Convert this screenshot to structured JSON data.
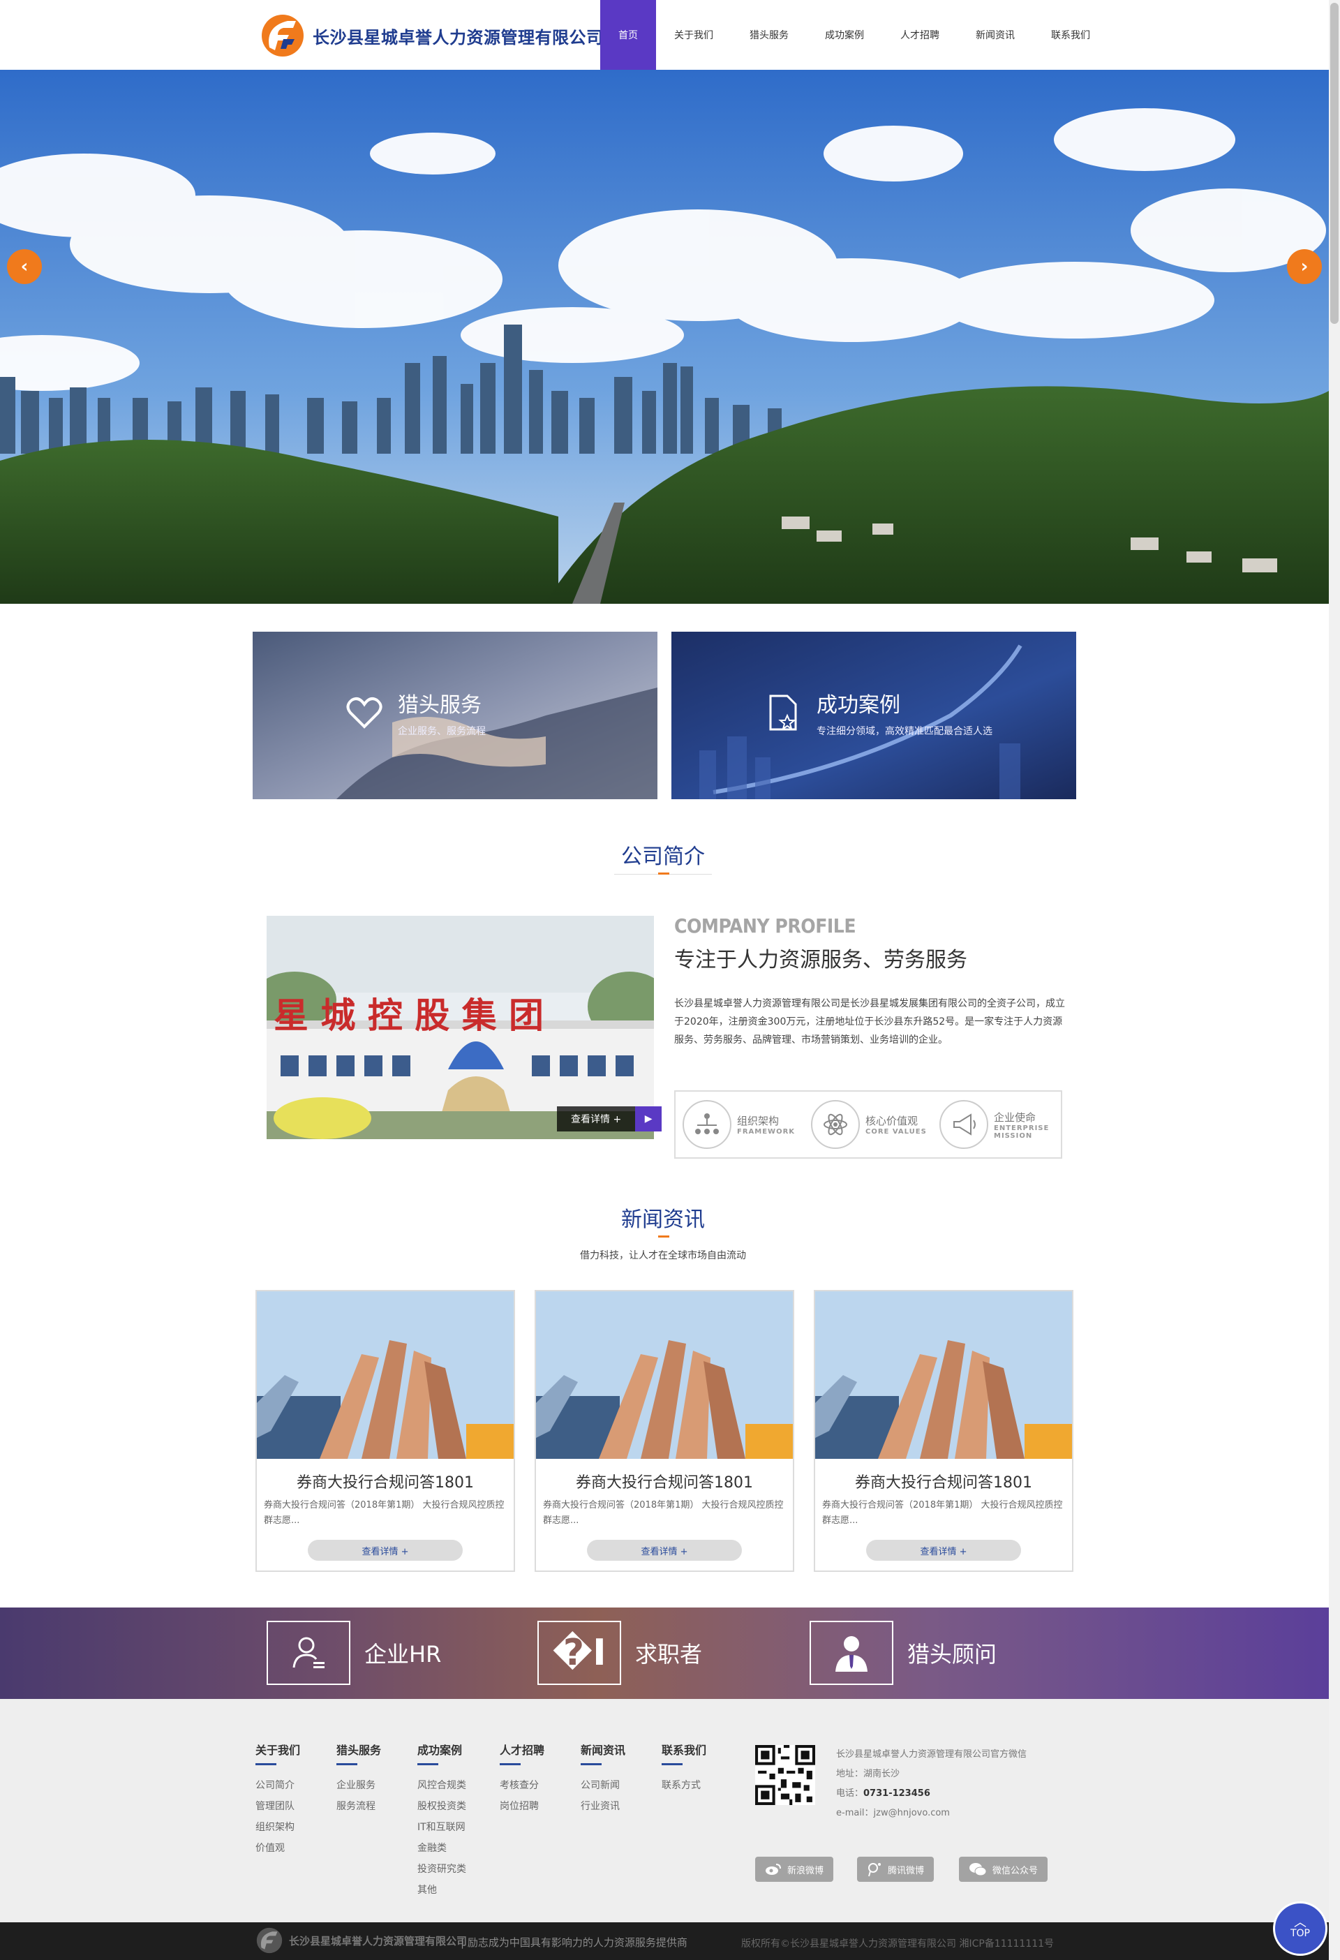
{
  "header": {
    "logo_text": "长沙县星城卓誉人力资源管理有限公司",
    "nav": [
      "首页",
      "关于我们",
      "猎头服务",
      "成功案例",
      "人才招聘",
      "新闻资讯",
      "联系我们"
    ]
  },
  "banner": {
    "prev": "‹",
    "next": "›"
  },
  "services": [
    {
      "title": "猎头服务",
      "subtitle": "企业服务、服务流程"
    },
    {
      "title": "成功案例",
      "subtitle": "专注细分领域，高效精准匹配最合适人选"
    }
  ],
  "profile": {
    "heading": "公司简介",
    "en_title": "COMPANY PROFILE",
    "cn_title": "专注于人力资源服务、劳务服务",
    "desc": "长沙县星城卓誉人力资源管理有限公司是长沙县星城发展集团有限公司的全资子公司，成立于2020年，注册资金300万元，注册地址位于长沙县东升路52号。是一家专注于人力资源服务、劳务服务、品牌管理、市场营销策划、业务培训的企业。",
    "more_label": "查看详情  +",
    "image_sign": "星 城 控 股 集 团",
    "icons": [
      {
        "cn": "组织架构",
        "en": "FRAMEWORK"
      },
      {
        "cn": "核心价值观",
        "en": "CORE VALUES"
      },
      {
        "cn": "企业使命",
        "en": "ENTERPRISE MISSION"
      }
    ]
  },
  "news": {
    "heading": "新闻资讯",
    "subtitle": "借力科技，让人才在全球市场自由流动",
    "items": [
      {
        "title": "券商大投行合规问答1801",
        "desc": "券商大投行合规问答（2018年第1期） 大投行合规风控质控群志愿...",
        "more": "查看详情 +"
      },
      {
        "title": "券商大投行合规问答1801",
        "desc": "券商大投行合规问答（2018年第1期） 大投行合规风控质控群志愿...",
        "more": "查看详情 +"
      },
      {
        "title": "券商大投行合规问答1801",
        "desc": "券商大投行合规问答（2018年第1期） 大投行合规风控质控群志愿...",
        "more": "查看详情 +"
      }
    ]
  },
  "roles": [
    {
      "label": "企业HR",
      "icon": "user-list-icon"
    },
    {
      "label": "求职者",
      "icon": "job-seeker-icon"
    },
    {
      "label": "猎头顾问",
      "icon": "consultant-icon"
    }
  ],
  "footer": {
    "columns": [
      {
        "title": "关于我们",
        "links": [
          "公司简介",
          "管理团队",
          "组织架构",
          "价值观"
        ]
      },
      {
        "title": "猎头服务",
        "links": [
          "企业服务",
          "服务流程"
        ]
      },
      {
        "title": "成功案例",
        "links": [
          "风控合规类",
          "股权投资类",
          "IT和互联网",
          "金融类",
          "投资研究类",
          "其他"
        ]
      },
      {
        "title": "人才招聘",
        "links": [
          "考核查分",
          "岗位招聘"
        ]
      },
      {
        "title": "新闻资讯",
        "links": [
          "公司新闻",
          "行业资讯"
        ]
      },
      {
        "title": "联系我们",
        "links": [
          "联系方式"
        ]
      }
    ],
    "info": {
      "wechat": "长沙县星城卓誉人力资源管理有限公司官方微信",
      "address": "地址：湖南长沙",
      "phone_label": "电话：",
      "phone": "0731-123456",
      "email": "e-mail：jzw@hnjovo.com"
    },
    "social": [
      "新浪微博",
      "腾讯微博",
      "微信公众号"
    ]
  },
  "bottom": {
    "logo_text": "长沙县星城卓誉人力资源管理有限公司",
    "slogan": "|  励志成为中国具有影响力的人力资源服务提供商",
    "copyright": "版权所有©长沙县星城卓誉人力资源管理有限公司 湘ICP备11111111号",
    "top": "TOP"
  },
  "colors": {
    "accent": "#5a39c4",
    "orange": "#f07a1c",
    "navy": "#1f3c8f"
  }
}
